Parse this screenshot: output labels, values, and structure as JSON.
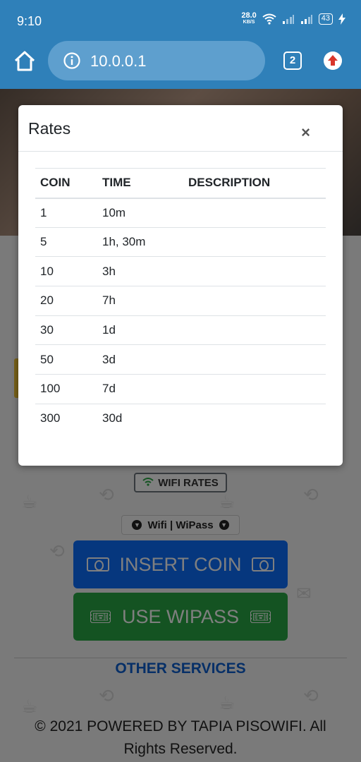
{
  "status_bar": {
    "time": "9:10",
    "speed_value": "28.0",
    "speed_unit": "KB/S",
    "battery": "43"
  },
  "browser": {
    "url": "10.0.0.1",
    "tab_count": "2"
  },
  "modal": {
    "title": "Rates",
    "close_symbol": "×",
    "columns": [
      "COIN",
      "TIME",
      "DESCRIPTION"
    ],
    "rows": [
      {
        "coin": "1",
        "time": "10m",
        "description": ""
      },
      {
        "coin": "5",
        "time": "1h, 30m",
        "description": ""
      },
      {
        "coin": "10",
        "time": "3h",
        "description": ""
      },
      {
        "coin": "20",
        "time": "7h",
        "description": ""
      },
      {
        "coin": "30",
        "time": "1d",
        "description": ""
      },
      {
        "coin": "50",
        "time": "3d",
        "description": ""
      },
      {
        "coin": "100",
        "time": "7d",
        "description": ""
      },
      {
        "coin": "300",
        "time": "30d",
        "description": ""
      }
    ]
  },
  "page": {
    "wifi_rates_label": "WIFI RATES",
    "wipass_select_label": "Wifi | WiPass",
    "insert_coin_label": "INSERT COIN",
    "use_wipass_label": "USE WIPASS",
    "other_services_label": "OTHER SERVICES",
    "footer_text": "© 2021 POWERED BY TAPIA PISOWIFI. All Rights Reserved."
  },
  "colors": {
    "toolbar": "#2f80b9",
    "insert_coin": "#0d6efd",
    "use_wipass": "#28a745",
    "link": "#0d5fcf"
  }
}
